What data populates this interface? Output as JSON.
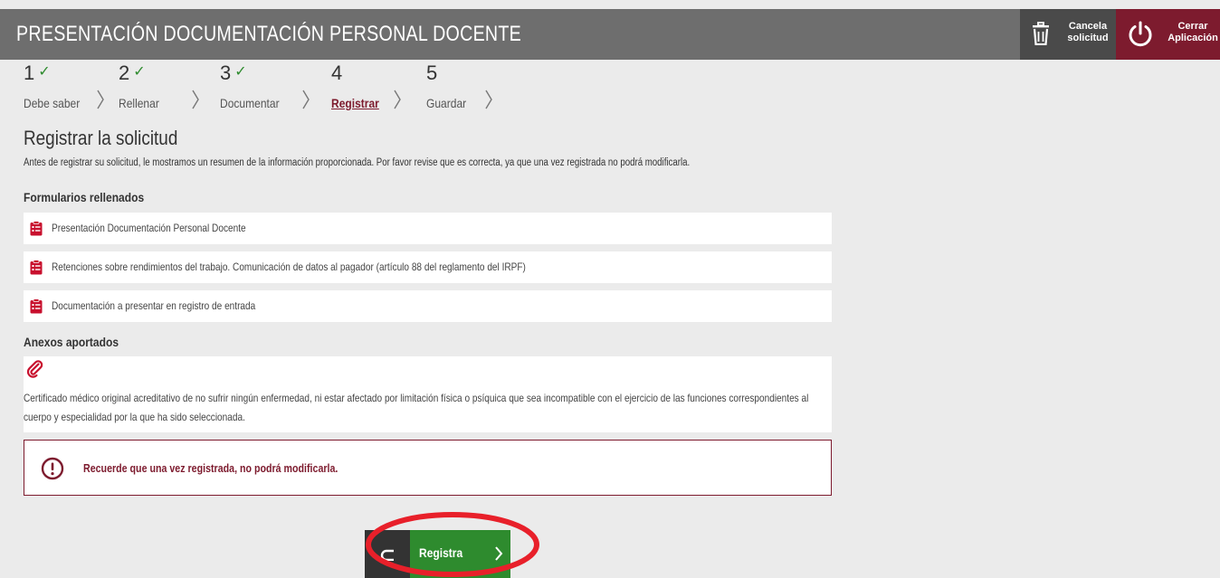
{
  "header": {
    "title": "PRESENTACIÓN DOCUMENTACIÓN PERSONAL DOCENTE",
    "cancel_line1": "Cancela",
    "cancel_line2": "solicitud",
    "close_line1": "Cerrar",
    "close_line2": "Aplicación"
  },
  "steps": [
    {
      "number": "1",
      "label": "Debe saber",
      "done": true
    },
    {
      "number": "2",
      "label": "Rellenar",
      "done": true
    },
    {
      "number": "3",
      "label": "Documentar",
      "done": true
    },
    {
      "number": "4",
      "label": "Registrar",
      "active": true
    },
    {
      "number": "5",
      "label": "Guardar"
    }
  ],
  "check_mark": "✓",
  "page": {
    "title": "Registrar la solicitud",
    "intro": "Antes de registrar su solicitud, le mostramos un resumen de la información proporcionada. Por favor revise que es correcta, ya que una vez registrada no podrá modificarla."
  },
  "forms": {
    "heading": "Formularios rellenados",
    "items": [
      "Presentación Documentación Personal Docente",
      "Retenciones sobre rendimientos del trabajo. Comunicación de datos al pagador (artículo 88 del reglamento del IRPF)",
      "Documentación a presentar en registro de entrada"
    ]
  },
  "annexes": {
    "heading": "Anexos aportados",
    "items": [
      "Certificado médico original acreditativo de no sufrir ningún enfermedad, ni estar afectado por limitación física o psíquica que sea incompatible con el ejercicio de las funciones correspondientes al cuerpo y especialidad por la que ha sido seleccionada."
    ]
  },
  "warning": {
    "text": "Recuerde que una vez registrada, no podrá modificarla."
  },
  "actions": {
    "register_label": "Registra"
  },
  "colors": {
    "header_bg": "#6e6e6e",
    "cancel_bg": "#4a4a4a",
    "brand_maroon": "#7d1b2e",
    "check_green": "#2e8b2e",
    "register_green": "#2e8b2e",
    "form_icon_red": "#c8102e",
    "highlight_red": "#e8202a"
  }
}
